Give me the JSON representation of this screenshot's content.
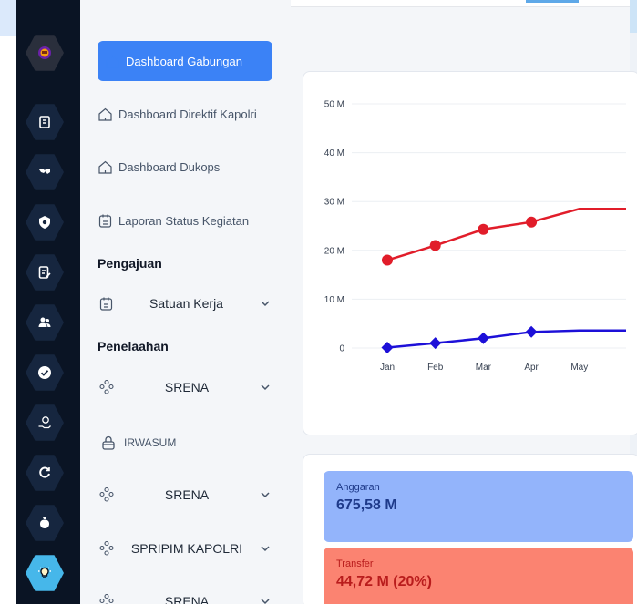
{
  "rail": {
    "icons": [
      "police-badge-logo",
      "document-icon",
      "handshake-icon",
      "shield-cog-icon",
      "file-edit-icon",
      "users-icon",
      "check-circle-icon",
      "money-hand-icon",
      "refresh-icon",
      "money-bag-icon",
      "lightbulb-icon"
    ]
  },
  "menu": {
    "dashboards": [
      {
        "label": "Dashboard Gabungan",
        "active": true
      },
      {
        "label": "Dashboard Direktif Kapolri",
        "active": false
      },
      {
        "label": "Dashboard Dukops",
        "active": false
      },
      {
        "label": "Laporan Status Kegiatan",
        "active": false
      }
    ],
    "pengajuan": {
      "title": "Pengajuan",
      "items": [
        {
          "label": "Satuan Kerja"
        }
      ]
    },
    "penelaahan": {
      "title": "Penelaahan",
      "items": [
        {
          "label": "SRENA",
          "type": "dropdown"
        },
        {
          "label": "IRWASUM",
          "type": "link"
        },
        {
          "label": "SRENA",
          "type": "dropdown"
        },
        {
          "label": "SPRIPIM KAPOLRI",
          "type": "dropdown"
        },
        {
          "label": "SRENA",
          "type": "dropdown"
        }
      ]
    }
  },
  "chart_data": {
    "type": "line",
    "categories": [
      "Jan",
      "Feb",
      "Mar",
      "Apr",
      "May"
    ],
    "y_ticks": [
      "0",
      "10 M",
      "20 M",
      "30 M",
      "40 M",
      "50 M"
    ],
    "ylim": [
      0,
      50
    ],
    "series": [
      {
        "color": "#e11d2a",
        "marker": "circle",
        "values": [
          18,
          21,
          24.3,
          25.8,
          28.5
        ]
      },
      {
        "color": "#1d10d8",
        "marker": "diamond",
        "values": [
          0.1,
          1.0,
          2.0,
          3.3,
          3.6
        ]
      }
    ]
  },
  "stats": {
    "anggaran": {
      "label": "Anggaran",
      "value": "675,58 M"
    },
    "transfer": {
      "label": "Transfer",
      "value": "44,72 M (20%)"
    }
  },
  "colors": {
    "accent": "#3b82f6",
    "rail": "#0a1424",
    "active_rail": "#46b7ea"
  }
}
